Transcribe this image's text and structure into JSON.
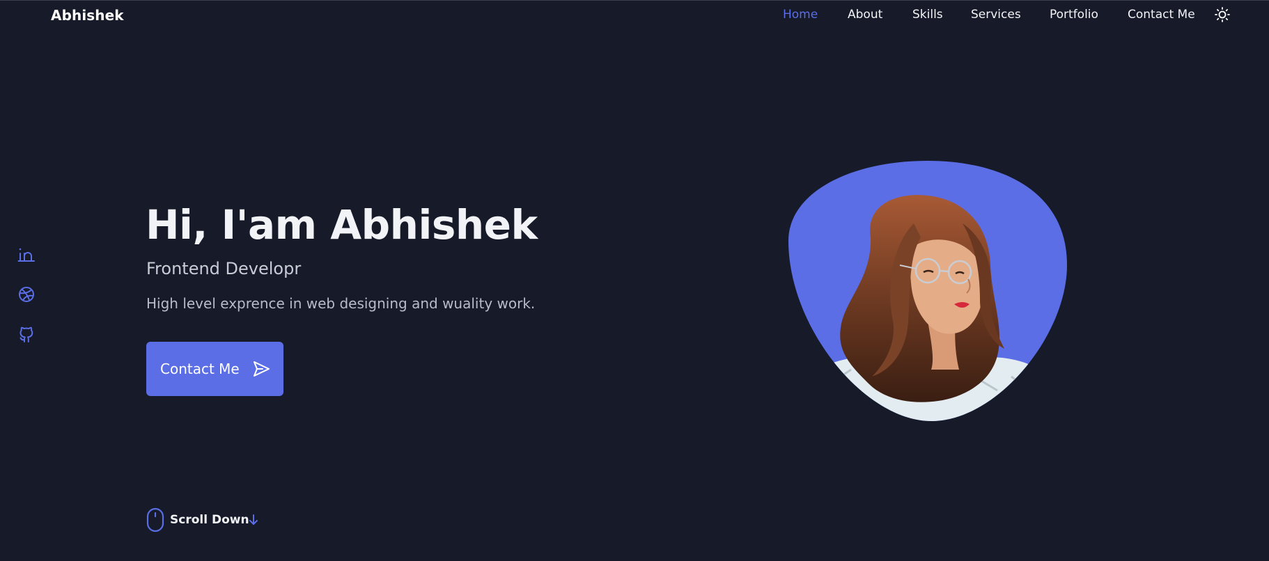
{
  "header": {
    "logo": "Abhishek",
    "nav": [
      {
        "label": "Home",
        "active": true
      },
      {
        "label": "About",
        "active": false
      },
      {
        "label": "Skills",
        "active": false
      },
      {
        "label": "Services",
        "active": false
      },
      {
        "label": "Portfolio",
        "active": false
      },
      {
        "label": "Contact Me",
        "active": false
      }
    ],
    "theme_icon": "sun-icon"
  },
  "social": [
    {
      "icon": "linkedin-icon"
    },
    {
      "icon": "dribbble-icon"
    },
    {
      "icon": "github-icon"
    }
  ],
  "hero": {
    "title": "Hi, I'am Abhishek",
    "subtitle": "Frontend Developr",
    "description": "High level exprence in web designing and wuality work.",
    "button_label": "Contact Me",
    "button_icon": "send-icon"
  },
  "scroll": {
    "label": "Scroll Down",
    "icon": "mouse-icon",
    "arrow_icon": "arrow-down-icon"
  },
  "colors": {
    "background": "#161a29",
    "accent": "#5b6ee6",
    "text": "#f2f3f7"
  }
}
